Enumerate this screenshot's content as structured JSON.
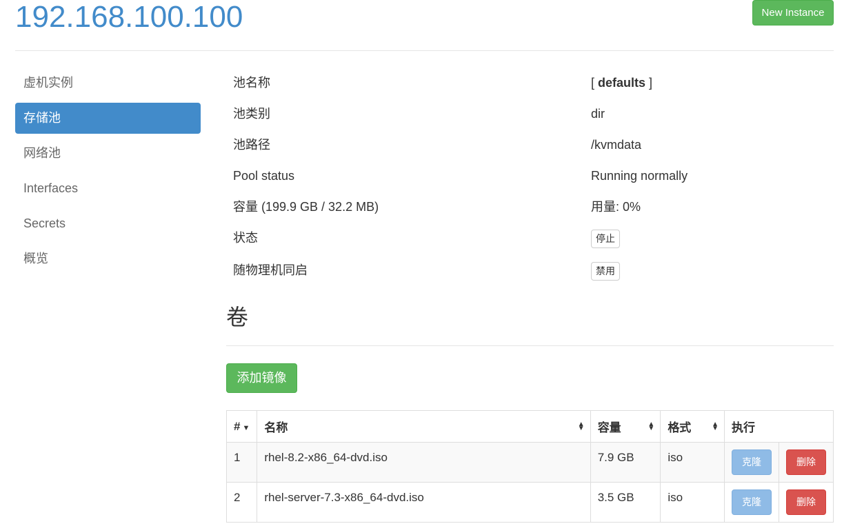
{
  "header": {
    "host": "192.168.100.100",
    "new_instance": "New Instance"
  },
  "sidebar": {
    "items": [
      {
        "label": "虚机实例"
      },
      {
        "label": "存储池"
      },
      {
        "label": "网络池"
      },
      {
        "label": "Interfaces"
      },
      {
        "label": "Secrets"
      },
      {
        "label": "概览"
      }
    ]
  },
  "pool": {
    "name_label": "池名称",
    "name_prefix": "[ ",
    "name_value": "defaults",
    "name_suffix": " ]",
    "type_label": "池类别",
    "type_value": "dir",
    "path_label": "池路径",
    "path_value": "/kvmdata",
    "status_label": "Pool status",
    "status_value": "Running normally",
    "capacity_label": "容量 (199.9 GB / 32.2 MB)",
    "usage_value": "用量: 0%",
    "state_label": "状态",
    "state_button": "停止",
    "autostart_label": "随物理机同启",
    "autostart_button": "禁用"
  },
  "volumes": {
    "heading": "卷",
    "add_button": "添加镜像",
    "columns": [
      "#",
      "名称",
      "容量",
      "格式",
      "执行"
    ],
    "rows": [
      {
        "num": "1",
        "name": "rhel-8.2-x86_64-dvd.iso",
        "size": "7.9 GB",
        "format": "iso",
        "clone": "克隆",
        "delete": "删除"
      },
      {
        "num": "2",
        "name": "rhel-server-7.3-x86_64-dvd.iso",
        "size": "3.5 GB",
        "format": "iso",
        "clone": "克隆",
        "delete": "删除"
      }
    ]
  },
  "colors": {
    "accent": "#428bca",
    "success": "#5cb85c",
    "danger": "#d9534f",
    "info": "#8fbbe6"
  },
  "icons": {
    "sort": "sort-both-icon",
    "sort_desc": "caret-down-icon"
  }
}
